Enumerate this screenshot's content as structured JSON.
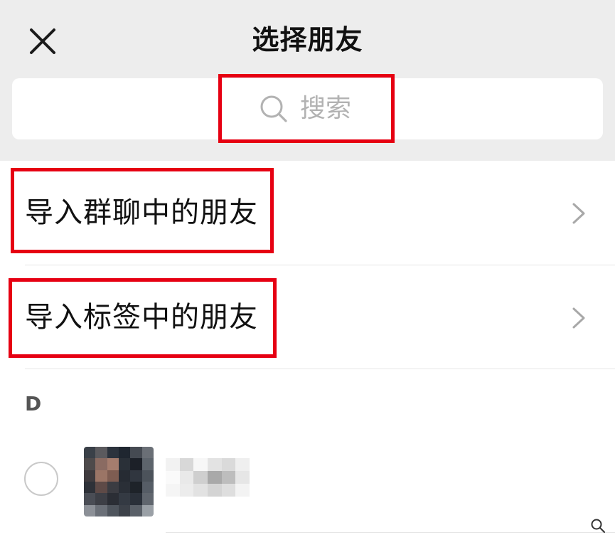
{
  "header": {
    "title": "选择朋友",
    "close_icon": "close-icon"
  },
  "search": {
    "placeholder": "搜索",
    "icon": "search-icon"
  },
  "menu": {
    "items": [
      {
        "label": "导入群聊中的朋友",
        "icon": "chevron-right-icon"
      },
      {
        "label": "导入标签中的朋友",
        "icon": "chevron-right-icon"
      }
    ]
  },
  "contacts": {
    "section_letter": "D"
  },
  "colors": {
    "header_bg": "#ededed",
    "highlight_red": "#e60012",
    "text_primary": "#111111",
    "placeholder_gray": "#b2b2b2"
  }
}
